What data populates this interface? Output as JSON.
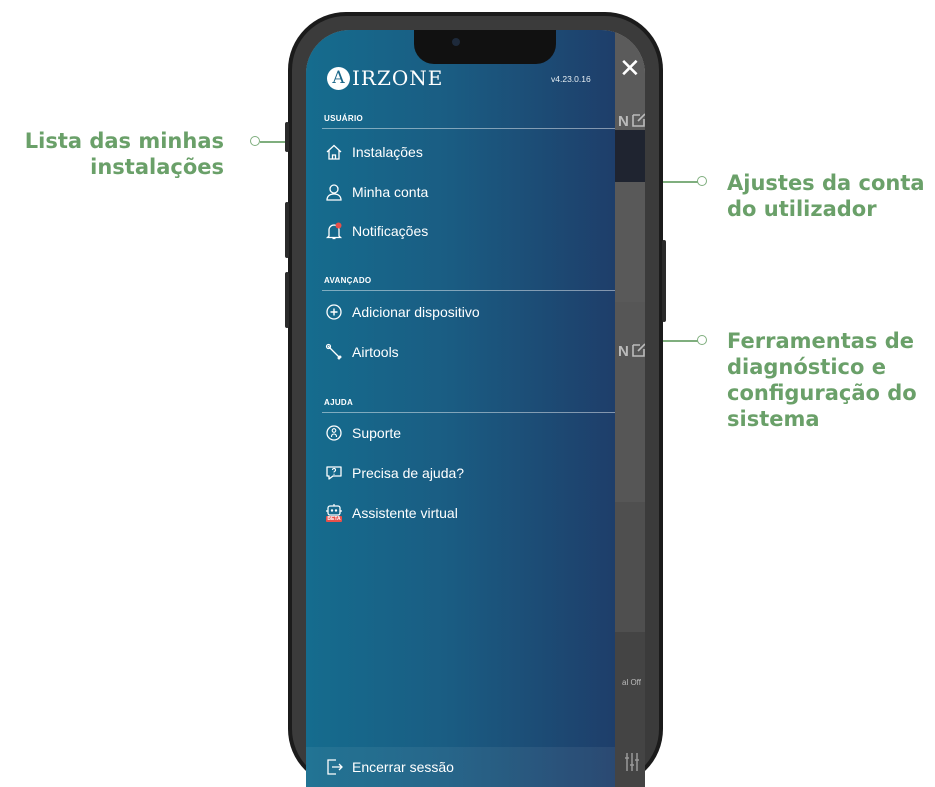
{
  "annotations": {
    "left_line1": "Lista das minhas",
    "left_line2": "instalações",
    "account_line1": "Ajustes da conta",
    "account_line2": "do utilizador",
    "tools_line1": "Ferramentas de",
    "tools_line2": "diagnóstico e",
    "tools_line3": "configuração do",
    "tools_line4": "sistema"
  },
  "drawer": {
    "logo_letter": "A",
    "logo_text": "IRZONE",
    "version": "v4.23.0.16",
    "sections": {
      "user": "USUÁRIO",
      "advanced": "AVANÇADO",
      "help": "AJUDA"
    },
    "items": {
      "installations": "Instalações",
      "account": "Minha conta",
      "notifications": "Notificações",
      "add_device": "Adicionar dispositivo",
      "airtools": "Airtools",
      "support": "Suporte",
      "need_help": "Precisa de ajuda?",
      "assistant": "Assistente virtual",
      "assistant_badge": "BETA",
      "logout": "Encerrar sessão"
    }
  },
  "background_app": {
    "close_symbol": "✕",
    "edit_letter": "N",
    "small_text": "al Off"
  },
  "colors": {
    "annotation_green": "#6aa069",
    "drawer_top": "#156c8e",
    "drawer_bottom": "#1e3e6a",
    "notification_dot": "#e8504a"
  },
  "icons": [
    "home-icon",
    "user-icon",
    "bell-icon",
    "plus-circle-icon",
    "wrench-icon",
    "support-icon",
    "help-bubble-icon",
    "robot-icon",
    "logout-icon",
    "close-icon",
    "edit-icon"
  ]
}
